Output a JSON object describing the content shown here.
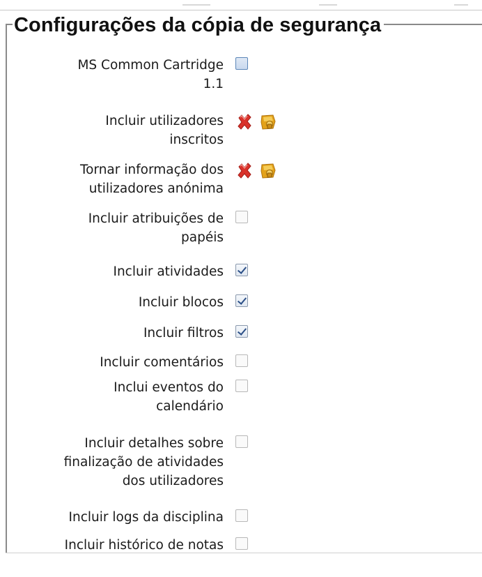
{
  "section": {
    "title": "Configurações da cópia de segurança"
  },
  "settings": [
    {
      "label": "MS Common Cartridge\n1.1",
      "state": "unchecked-blue",
      "locked": false
    },
    {
      "label": "Incluir utilizadores\ninscritos",
      "state": "locked-no",
      "locked": true
    },
    {
      "label": "Tornar informação dos\nutilizadores anónima",
      "state": "locked-no",
      "locked": true
    },
    {
      "label": "Incluir atribuições de\npapéis",
      "state": "unchecked",
      "locked": false
    },
    {
      "label": "Incluir atividades",
      "state": "checked",
      "locked": false
    },
    {
      "label": "Incluir blocos",
      "state": "checked",
      "locked": false
    },
    {
      "label": "Incluir filtros",
      "state": "checked",
      "locked": false
    },
    {
      "label": "Incluir comentários",
      "state": "unchecked",
      "locked": false
    },
    {
      "label": "Inclui eventos do\ncalendário",
      "state": "unchecked",
      "locked": false
    },
    {
      "label": "Incluir detalhes sobre\nfinalização de atividades\ndos utilizadores",
      "state": "unchecked",
      "locked": false
    },
    {
      "label": "Incluir logs da disciplina",
      "state": "unchecked",
      "locked": false
    },
    {
      "label": "Incluir histórico de notas",
      "state": "unchecked",
      "locked": false
    }
  ],
  "icons": {
    "no": "red-x-icon",
    "lock": "padlock-icon"
  },
  "colors": {
    "red_x": "#d9322b",
    "lock": "#e3a21a",
    "check": "#2b4f87"
  }
}
